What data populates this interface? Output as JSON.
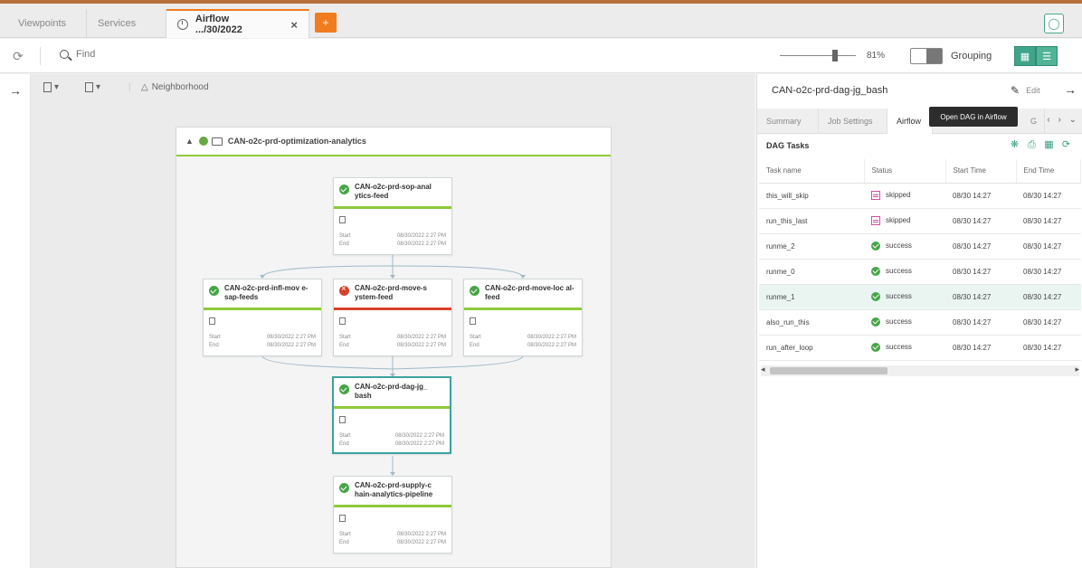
{
  "tabs": [
    {
      "label": "Viewpoints"
    },
    {
      "label": "Services"
    },
    {
      "label": "Airflow .../30/2022"
    }
  ],
  "tab_add_label": "+",
  "toolbar": {
    "find_placeholder": "Find",
    "zoom_level": "81%",
    "grouping_label": "Grouping"
  },
  "canvas": {
    "neighborhood_label": "Neighborhood",
    "group_title": "CAN-o2c-prd-optimization-analytics",
    "nodes": [
      {
        "title": "CAN-o2c-prd-sop-anal ytics-feed",
        "start": "08/30/2022 2:27 PM",
        "end": "08/30/2022 2:27 PM",
        "status": "success"
      },
      {
        "title": "CAN-o2c-prd-infl-mov e-sap-feeds",
        "start": "08/30/2022 2:27 PM",
        "end": "08/30/2022 2:27 PM",
        "status": "success"
      },
      {
        "title": "CAN-o2c-prd-move-s ystem-feed",
        "start": "08/30/2022 2:27 PM",
        "end": "08/30/2022 2:27 PM",
        "status": "failed"
      },
      {
        "title": "CAN-o2c-prd-move-loc al-feed",
        "start": "08/30/2022 2:27 PM",
        "end": "08/30/2022 2:27 PM",
        "status": "success"
      },
      {
        "title": "CAN-o2c-prd-dag-jg_ bash",
        "start": "08/30/2022 2:27 PM",
        "end": "08/30/2022 2:27 PM",
        "status": "success"
      },
      {
        "title": "CAN-o2c-prd-supply-c hain-analytics-pipeline",
        "start": "08/30/2022 2:27 PM",
        "end": "08/30/2022 2:27 PM",
        "status": "success"
      }
    ],
    "start_label": "Start",
    "end_label": "End"
  },
  "panel": {
    "title": "CAN-o2c-prd-dag-jg_bash",
    "edit_label": "Edit",
    "tabs": [
      "Summary",
      "Job Settings",
      "Airflow",
      "G"
    ],
    "tooltip": "Open DAG in Airflow",
    "dag_tasks_label": "DAG Tasks",
    "columns": [
      "Task name",
      "Status",
      "Start Time",
      "End Time"
    ],
    "rows": [
      {
        "name": "this_will_skip",
        "status": "skipped",
        "start": "08/30 14:27",
        "end": "08/30 14:27"
      },
      {
        "name": "run_this_last",
        "status": "skipped",
        "start": "08/30 14:27",
        "end": "08/30 14:27"
      },
      {
        "name": "runme_2",
        "status": "success",
        "start": "08/30 14:27",
        "end": "08/30 14:27"
      },
      {
        "name": "runme_0",
        "status": "success",
        "start": "08/30 14:27",
        "end": "08/30 14:27"
      },
      {
        "name": "runme_1",
        "status": "success",
        "start": "08/30 14:27",
        "end": "08/30 14:27"
      },
      {
        "name": "also_run_this",
        "status": "success",
        "start": "08/30 14:27",
        "end": "08/30 14:27"
      },
      {
        "name": "run_after_loop",
        "status": "success",
        "start": "08/30 14:27",
        "end": "08/30 14:27"
      }
    ],
    "highlighted_row": 4
  },
  "colors": {
    "accent": "#f07c1f",
    "success": "#47a548",
    "failed": "#d9402b",
    "teal": "#3fa48a"
  }
}
